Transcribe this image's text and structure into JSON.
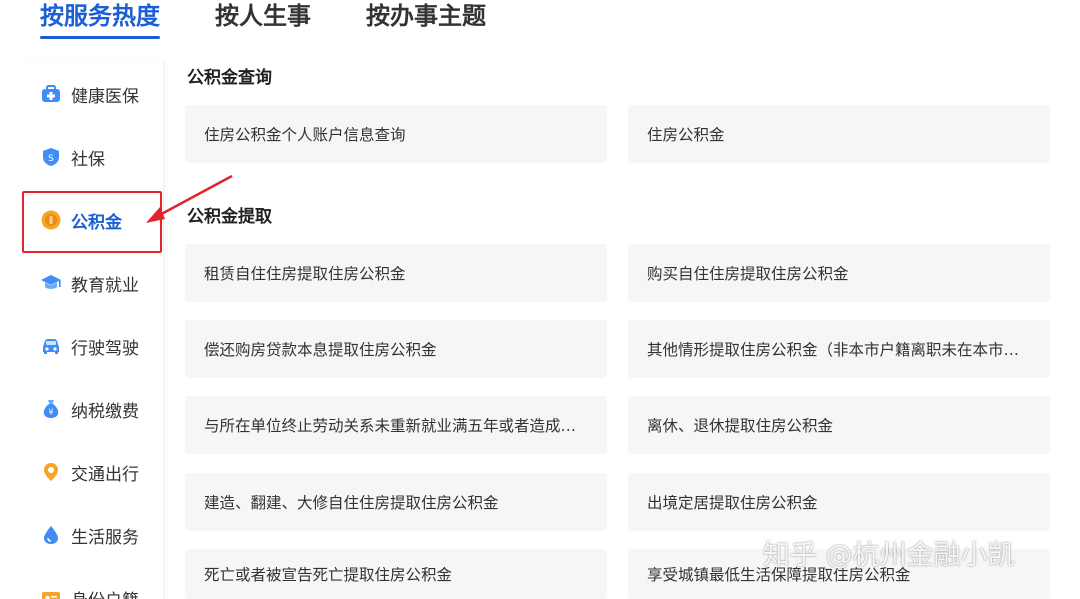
{
  "tabs": [
    {
      "label": "按服务热度",
      "active": true
    },
    {
      "label": "按人生事"
    },
    {
      "label": "按办事主题"
    }
  ],
  "sidebar": {
    "items": [
      {
        "label": "健康医保",
        "icon": "medical-kit-icon"
      },
      {
        "label": "社保",
        "icon": "shield-icon"
      },
      {
        "label": "公积金",
        "icon": "coin-icon",
        "active": true
      },
      {
        "label": "教育就业",
        "icon": "graduation-cap-icon"
      },
      {
        "label": "行驶驾驶",
        "icon": "car-icon"
      },
      {
        "label": "纳税缴费",
        "icon": "money-bag-icon"
      },
      {
        "label": "交通出行",
        "icon": "location-pin-icon"
      },
      {
        "label": "生活服务",
        "icon": "drop-icon"
      },
      {
        "label": "身份户籍",
        "icon": "id-card-icon"
      }
    ]
  },
  "sections": [
    {
      "title": "公积金查询",
      "items": [
        "住房公积金个人账户信息查询",
        "住房公积金"
      ]
    },
    {
      "title": "公积金提取",
      "items": [
        "租赁自住住房提取住房公积金",
        "购买自住住房提取住房公积金",
        "偿还购房贷款本息提取住房公积金",
        "其他情形提取住房公积金（非本市户籍离职未在本市…",
        "与所在单位终止劳动关系未重新就业满五年或者造成…",
        "离休、退休提取住房公积金",
        "建造、翻建、大修自住住房提取住房公积金",
        "出境定居提取住房公积金",
        "死亡或者被宣告死亡提取住房公积金",
        "享受城镇最低生活保障提取住房公积金"
      ]
    }
  ],
  "watermark": "知乎 @杭州金融小凯",
  "colors": {
    "accent": "#1a5fd6",
    "highlight": "#e0262c",
    "card_bg": "#f5f6f8"
  }
}
